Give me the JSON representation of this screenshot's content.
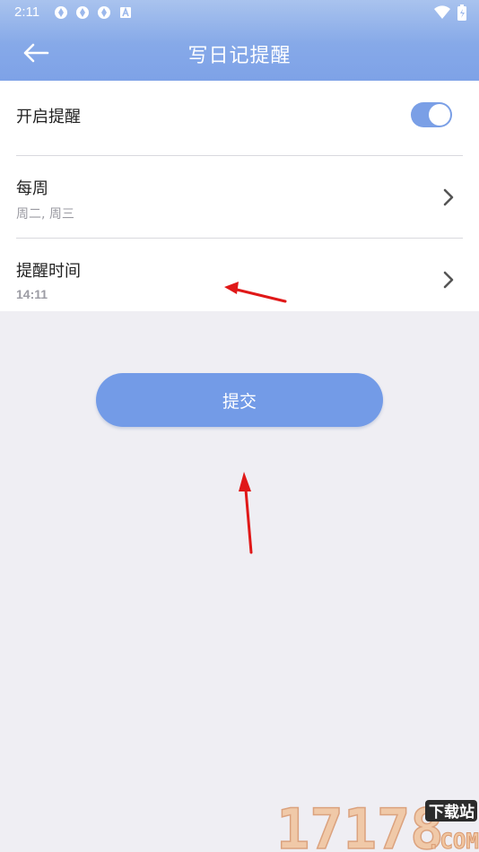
{
  "status_bar": {
    "time": "2:11",
    "icons": [
      "sync-icon",
      "sync-icon",
      "sync-icon",
      "a-icon"
    ],
    "right_icons": [
      "wifi-icon",
      "battery-icon"
    ]
  },
  "app_bar": {
    "title": "写日记提醒",
    "back_icon": "arrow-left-icon"
  },
  "settings": {
    "enable": {
      "label": "开启提醒",
      "enabled": true
    },
    "weekly": {
      "label": "每周",
      "value": "周二, 周三"
    },
    "time": {
      "label": "提醒时间",
      "value": "14:11"
    }
  },
  "submit": {
    "label": "提交"
  },
  "colors": {
    "accent": "#739be7",
    "header_top": "#a9c3ee",
    "header_bottom": "#7ea2e7",
    "background": "#efeef3",
    "annotation": "#e01818"
  },
  "watermark": {
    "brand": "17178",
    "tag": "下载站",
    "suffix": ".COM"
  }
}
